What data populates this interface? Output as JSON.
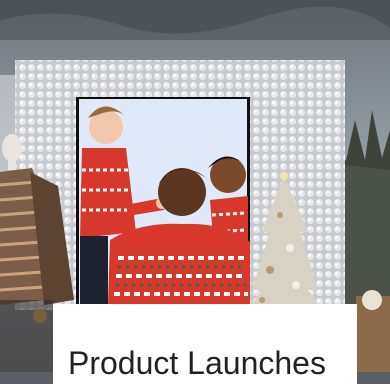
{
  "caption": {
    "title": "Product Launches"
  },
  "colors": {
    "sky": "#9aa3ab",
    "sequin_wall": "#c9ccd0",
    "poster_background": "#dfe9f7",
    "sweater_red": "#d8382c",
    "card": "#ffffff",
    "caption_text": "#222222"
  }
}
